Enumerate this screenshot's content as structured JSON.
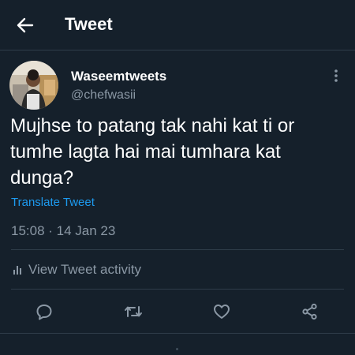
{
  "header": {
    "title": "Tweet"
  },
  "tweet": {
    "author_name": "Waseemtweets",
    "author_handle": "@chefwasii",
    "text": "Mujhse to patang tak nahi kat ti or tumhe lagta hai mai tumhara kat dunga?",
    "translate_label": "Translate Tweet",
    "timestamp": "15:08 · 14 Jan 23",
    "activity_label": "View Tweet activity"
  },
  "icons": {
    "back": "arrow-left-icon",
    "more": "more-vertical-icon",
    "activity": "bar-chart-icon",
    "reply": "reply-icon",
    "retweet": "retweet-icon",
    "like": "heart-icon",
    "share": "share-icon"
  },
  "colors": {
    "background": "#15202b",
    "text": "#ffffff",
    "secondary": "#8b98a5",
    "link": "#1d9bf0",
    "divider": "#2f3d4a"
  }
}
